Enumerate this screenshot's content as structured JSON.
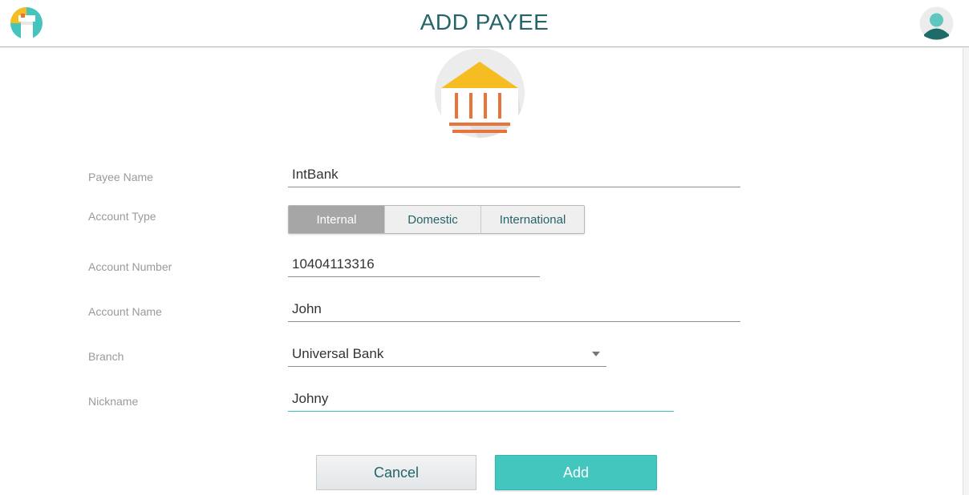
{
  "header": {
    "title": "ADD PAYEE",
    "logo_icon": "app-logo-icon",
    "avatar_icon": "user-avatar-icon"
  },
  "badge_icon": "bank-icon",
  "form": {
    "payee_name": {
      "label": "Payee Name",
      "value": "IntBank"
    },
    "account_type": {
      "label": "Account Type",
      "options": [
        "Internal",
        "Domestic",
        "International"
      ],
      "selected": "Internal"
    },
    "account_number": {
      "label": "Account Number",
      "value": "10404113316"
    },
    "account_name": {
      "label": "Account Name",
      "value": "John"
    },
    "branch": {
      "label": "Branch",
      "value": "Universal Bank"
    },
    "nickname": {
      "label": "Nickname",
      "value": "Johny"
    }
  },
  "actions": {
    "cancel_label": "Cancel",
    "add_label": "Add"
  },
  "colors": {
    "accent": "#42c6be",
    "title": "#24646a",
    "bank_roof": "#f6bd22",
    "bank_columns": "#e8743b"
  }
}
